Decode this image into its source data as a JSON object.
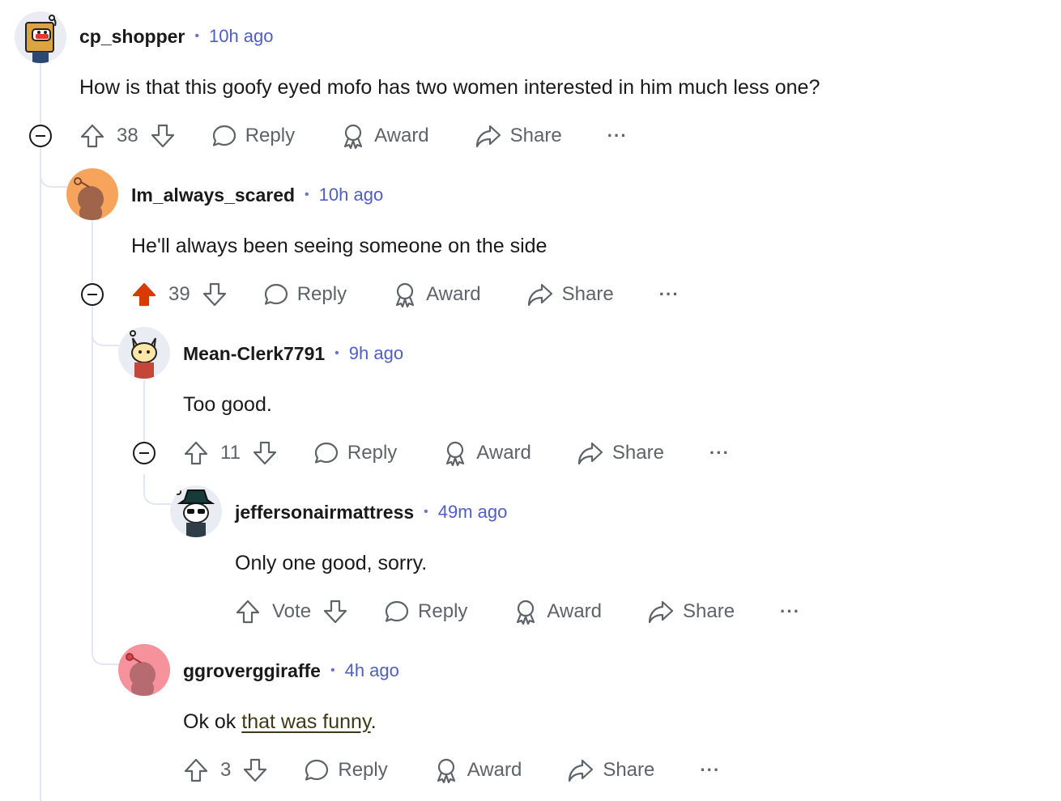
{
  "colors": {
    "thread_line": "#e3e6f2",
    "username": "#1a1a1b",
    "timestamp": "#4f5dc6",
    "action_text": "#5e6368",
    "upvote_active": "#d93a00",
    "link_text": "#3f3a16"
  },
  "comments": [
    {
      "username": "cp_shopper",
      "time": "10h ago",
      "body": "How is that this goofy eyed mofo has two women interested in him much less one?",
      "score": "38",
      "reply": "Reply",
      "award": "Award",
      "share": "Share",
      "more": "···",
      "avatar_icon": "snoo-avatar-box-character"
    },
    {
      "username": "Im_always_scared",
      "time": "10h ago",
      "body": "He'll always been seeing someone on the side",
      "score": "39",
      "upvoted": true,
      "reply": "Reply",
      "award": "Award",
      "share": "Share",
      "more": "···",
      "avatar_icon": "default-snoo-orange-avatar"
    },
    {
      "username": "Mean-Clerk7791",
      "time": "9h ago",
      "body": "Too good.",
      "score": "11",
      "reply": "Reply",
      "award": "Award",
      "share": "Share",
      "more": "···",
      "avatar_icon": "snoo-avatar-fox-character"
    },
    {
      "username": "jeffersonairmattress",
      "time": "49m ago",
      "body": "Only one good, sorry.",
      "score": "Vote",
      "reply": "Reply",
      "award": "Award",
      "share": "Share",
      "more": "···",
      "avatar_icon": "snoo-avatar-hat-sunglasses"
    },
    {
      "username": "ggroverggiraffe",
      "time": "4h ago",
      "body_prefix": "Ok ok ",
      "body_link": "that was funny",
      "body_suffix": ".",
      "score": "3",
      "reply": "Reply",
      "award": "Award",
      "share": "Share",
      "more": "···",
      "avatar_icon": "default-snoo-pink-avatar"
    }
  ]
}
